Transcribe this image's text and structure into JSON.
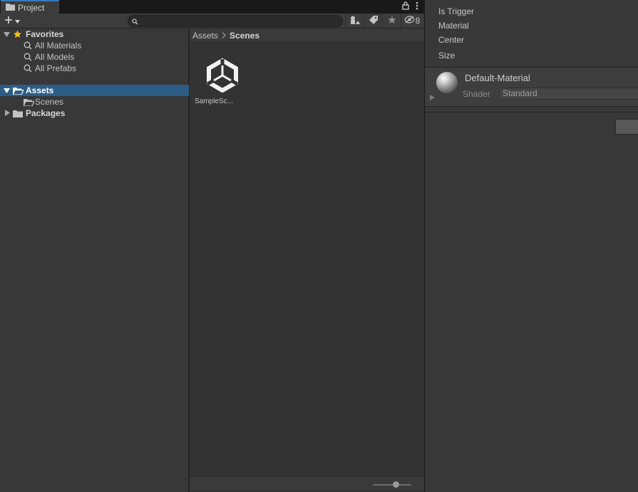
{
  "project": {
    "tab_label": "Project",
    "hidden_count": "8",
    "search": {
      "placeholder": ""
    },
    "tree": {
      "favorites": {
        "label": "Favorites",
        "items": [
          {
            "label": "All Materials"
          },
          {
            "label": "All Models"
          },
          {
            "label": "All Prefabs"
          }
        ]
      },
      "assets": {
        "label": "Assets",
        "children": [
          {
            "label": "Scenes"
          }
        ]
      },
      "packages": {
        "label": "Packages"
      }
    },
    "breadcrumb": {
      "root": "Assets",
      "current": "Scenes"
    },
    "assets": [
      {
        "name": "SampleSc...",
        "icon": "unity-scene-icon"
      }
    ],
    "zoom": 0.6
  },
  "inspector": {
    "collider_props": [
      {
        "label": "Is Trigger"
      },
      {
        "label": "Material"
      },
      {
        "label": "Center"
      },
      {
        "label": "Size"
      }
    ],
    "material": {
      "name": "Default-Material",
      "shader_label": "Shader",
      "shader_value": "Standard"
    }
  },
  "colors": {
    "selection": "#2c5d87",
    "tab_accent": "#3a79bb",
    "star": "#f4c21b"
  }
}
